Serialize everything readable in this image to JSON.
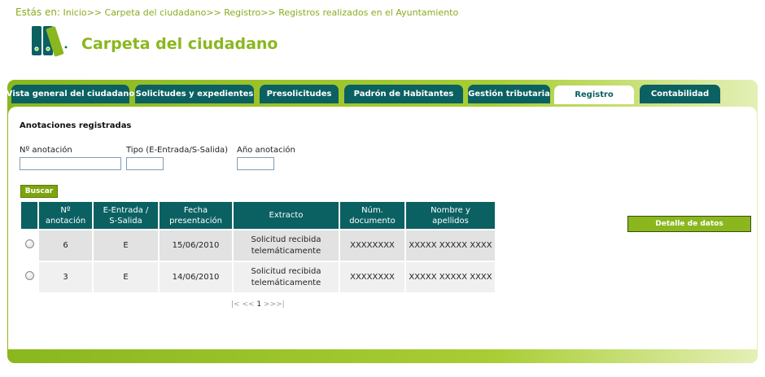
{
  "breadcrumb": {
    "label": "Estás en:",
    "items": [
      "Inicio",
      "Carpeta del ciudadano",
      "Registro",
      "Registros realizados en el Ayuntamiento"
    ],
    "separator": ">>"
  },
  "app": {
    "title": "Carpeta del ciudadano"
  },
  "tabs": [
    {
      "label": "Vista general del ciudadano",
      "active": false
    },
    {
      "label": "Solicitudes y expedientes",
      "active": false
    },
    {
      "label": "Presolicitudes",
      "active": false
    },
    {
      "label": "Padrón de Habitantes",
      "active": false
    },
    {
      "label": "Gestión tributaria",
      "active": false
    },
    {
      "label": "Registro",
      "active": true
    },
    {
      "label": "Contabilidad",
      "active": false
    }
  ],
  "search": {
    "title": "Anotaciones registradas",
    "fields": [
      {
        "label": "Nº anotación",
        "value": ""
      },
      {
        "label": "Tipo (E-Entrada/S-Salida)",
        "value": ""
      },
      {
        "label": "Año anotación",
        "value": ""
      }
    ],
    "button_label": "Buscar"
  },
  "table": {
    "headers": [
      [
        "Nº",
        "anotación"
      ],
      [
        "E-Entrada /",
        "S-Salida"
      ],
      [
        "Fecha",
        "presentación"
      ],
      [
        "Extracto"
      ],
      [
        "Núm.",
        "documento"
      ],
      [
        "Nombre y",
        "apellidos"
      ]
    ],
    "rows": [
      {
        "numero": "6",
        "tipo": "E",
        "fecha": "15/06/2010",
        "extracto": [
          "Solicitud recibida",
          "telemáticamente"
        ],
        "documento": "XXXXXXXX",
        "nombre": "XXXXX XXXXX XXXX"
      },
      {
        "numero": "3",
        "tipo": "E",
        "fecha": "14/06/2010",
        "extracto": [
          "Solicitud recibida",
          "telemáticamente"
        ],
        "documento": "XXXXXXXX",
        "nombre": "XXXXX XXXXX XXXX"
      }
    ]
  },
  "pagination": {
    "first": "|<",
    "prev": "<<",
    "current": "1",
    "next": ">>",
    "last": ">|"
  },
  "detail_button": "Detalle de datos",
  "colors": {
    "brand_green": "#8ab71e",
    "tab_teal": "#0b6062",
    "link_green": "#8bab1f"
  }
}
